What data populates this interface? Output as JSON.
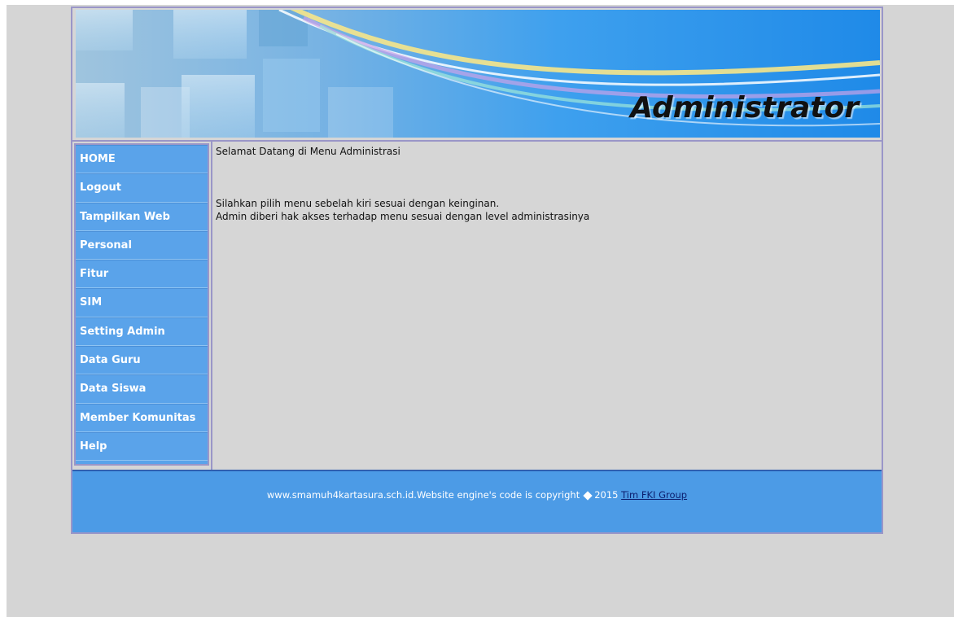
{
  "banner": {
    "title": "Administrator"
  },
  "sidebar": {
    "items": [
      {
        "label": "HOME"
      },
      {
        "label": "Logout"
      },
      {
        "label": "Tampilkan Web"
      },
      {
        "label": "Personal"
      },
      {
        "label": "Fitur"
      },
      {
        "label": "SIM"
      },
      {
        "label": "Setting Admin"
      },
      {
        "label": "Data Guru"
      },
      {
        "label": "Data Siswa"
      },
      {
        "label": "Member Komunitas"
      },
      {
        "label": "Help"
      }
    ]
  },
  "main": {
    "welcome": "Selamat Datang di Menu Administrasi",
    "line1": "Silahkan pilih menu sebelah kiri sesuai dengan keinginan.",
    "line2": "Admin diberi hak akses terhadap menu sesuai dengan level administrasinya"
  },
  "footer": {
    "text_before": "www.smamuh4kartasura.sch.id.Website engine's code is copyright",
    "year": "2015",
    "link": "Tim FKI Group"
  },
  "colors": {
    "sidebar": "#5aa3ea",
    "footer": "#4c9be6",
    "border": "#9a96c8",
    "page_bg": "#d5d5d5"
  }
}
